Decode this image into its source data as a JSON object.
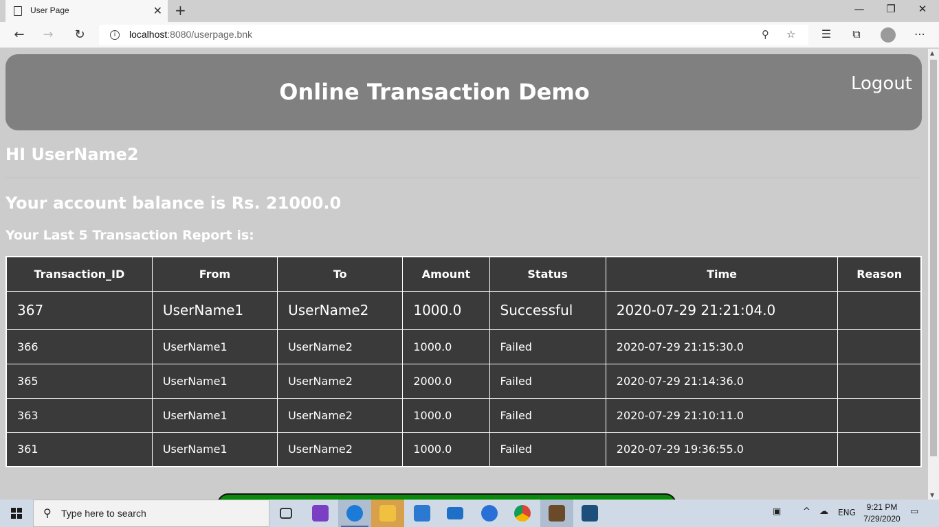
{
  "browser": {
    "tab_title": "User Page",
    "tab_close": "✕",
    "new_tab": "+",
    "url_host": "localhost",
    "url_path": ":8080/userpage.bnk",
    "minimize": "—",
    "restore": "❐",
    "close": "✕"
  },
  "header": {
    "title": "Online Transaction Demo",
    "logout_label": "Logout"
  },
  "greeting": "HI UserName2",
  "balance_text": "Your account balance is Rs. 21000.0",
  "report_heading": "Your Last 5 Transaction Report is:",
  "table": {
    "headers": [
      "Transaction_ID",
      "From",
      "To",
      "Amount",
      "Status",
      "Time",
      "Reason"
    ],
    "rows": [
      [
        "367",
        "UserName1",
        "UserName2",
        "1000.0",
        "Successful",
        "2020-07-29 21:21:04.0",
        ""
      ],
      [
        "366",
        "UserName1",
        "UserName2",
        "1000.0",
        "Failed",
        "2020-07-29 21:15:30.0",
        ""
      ],
      [
        "365",
        "UserName1",
        "UserName2",
        "2000.0",
        "Failed",
        "2020-07-29 21:14:36.0",
        ""
      ],
      [
        "363",
        "UserName1",
        "UserName2",
        "1000.0",
        "Failed",
        "2020-07-29 21:10:11.0",
        ""
      ],
      [
        "361",
        "UserName1",
        "UserName2",
        "1000.0",
        "Failed",
        "2020-07-29 19:36:55.0",
        ""
      ]
    ]
  },
  "colors": {
    "page_bg": "#cccccc",
    "header_bg": "#808080",
    "table_bg": "#3a3a3a",
    "green_bar": "#0a8a0a"
  },
  "taskbar": {
    "search_placeholder": "Type here to search",
    "language": "ENG",
    "time": "9:21 PM",
    "date": "7/29/2020"
  }
}
